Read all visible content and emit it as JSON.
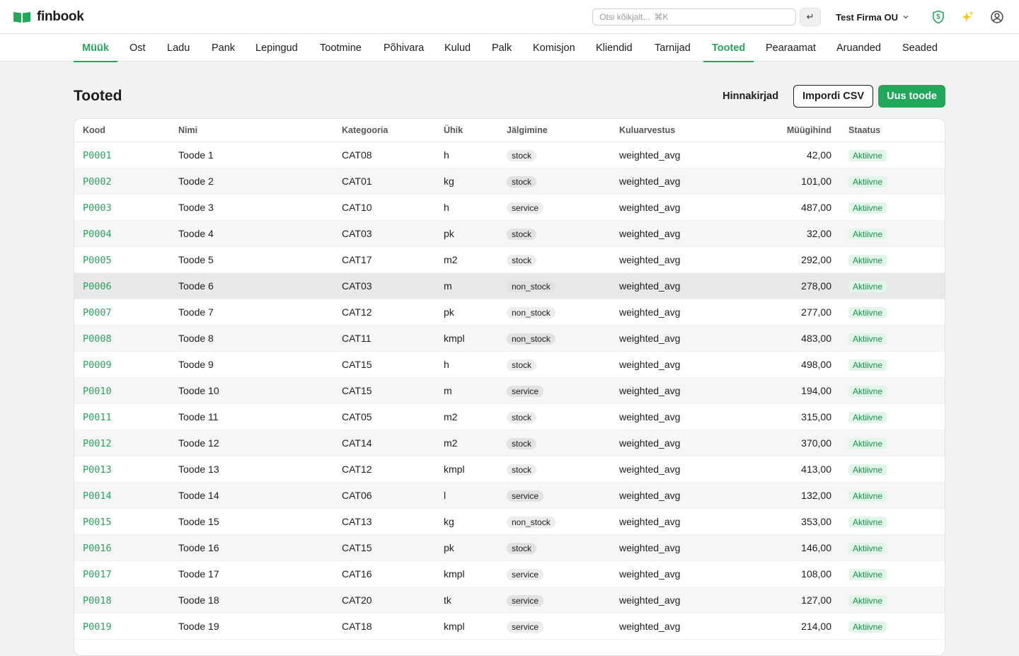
{
  "app": {
    "name": "finbook",
    "accent": "#22a85a"
  },
  "header": {
    "search_placeholder": "Otsi kõikjalt...",
    "search_shortcut": "⌘K",
    "enter_label": "↵",
    "company": "Test Firma OU",
    "icons": [
      "shield-icon",
      "sparkle-icon",
      "user-icon"
    ]
  },
  "nav": {
    "tabs": [
      {
        "label": "Müük",
        "active": true
      },
      {
        "label": "Ost",
        "active": false
      },
      {
        "label": "Ladu",
        "active": false
      },
      {
        "label": "Pank",
        "active": false
      },
      {
        "label": "Lepingud",
        "active": false
      },
      {
        "label": "Tootmine",
        "active": false
      },
      {
        "label": "Põhivara",
        "active": false
      },
      {
        "label": "Kulud",
        "active": false
      },
      {
        "label": "Palk",
        "active": false
      },
      {
        "label": "Komisjon",
        "active": false
      },
      {
        "label": "Kliendid",
        "active": false
      },
      {
        "label": "Tarnijad",
        "active": false
      },
      {
        "label": "Tooted",
        "active": true
      },
      {
        "label": "Pearaamat",
        "active": false
      },
      {
        "label": "Aruanded",
        "active": false
      },
      {
        "label": "Seaded",
        "active": false
      }
    ]
  },
  "page": {
    "title": "Tooted",
    "price_lists_label": "Hinnakirjad",
    "import_label": "Impordi CSV",
    "new_label": "Uus toode"
  },
  "table": {
    "columns": [
      "Kood",
      "Nimi",
      "Kategooria",
      "Ühik",
      "Jälgimine",
      "Kuluarvestus",
      "Müügihind",
      "Staatus"
    ],
    "rows": [
      {
        "code": "P0001",
        "name": "Toode 1",
        "category": "CAT08",
        "unit": "h",
        "tracking": "stock",
        "costing": "weighted_avg",
        "price": "42,00",
        "status": "Aktiivne"
      },
      {
        "code": "P0002",
        "name": "Toode 2",
        "category": "CAT01",
        "unit": "kg",
        "tracking": "stock",
        "costing": "weighted_avg",
        "price": "101,00",
        "status": "Aktiivne"
      },
      {
        "code": "P0003",
        "name": "Toode 3",
        "category": "CAT10",
        "unit": "h",
        "tracking": "service",
        "costing": "weighted_avg",
        "price": "487,00",
        "status": "Aktiivne"
      },
      {
        "code": "P0004",
        "name": "Toode 4",
        "category": "CAT03",
        "unit": "pk",
        "tracking": "stock",
        "costing": "weighted_avg",
        "price": "32,00",
        "status": "Aktiivne"
      },
      {
        "code": "P0005",
        "name": "Toode 5",
        "category": "CAT17",
        "unit": "m2",
        "tracking": "stock",
        "costing": "weighted_avg",
        "price": "292,00",
        "status": "Aktiivne"
      },
      {
        "code": "P0006",
        "name": "Toode 6",
        "category": "CAT03",
        "unit": "m",
        "tracking": "non_stock",
        "costing": "weighted_avg",
        "price": "278,00",
        "status": "Aktiivne"
      },
      {
        "code": "P0007",
        "name": "Toode 7",
        "category": "CAT12",
        "unit": "pk",
        "tracking": "non_stock",
        "costing": "weighted_avg",
        "price": "277,00",
        "status": "Aktiivne"
      },
      {
        "code": "P0008",
        "name": "Toode 8",
        "category": "CAT11",
        "unit": "kmpl",
        "tracking": "non_stock",
        "costing": "weighted_avg",
        "price": "483,00",
        "status": "Aktiivne"
      },
      {
        "code": "P0009",
        "name": "Toode 9",
        "category": "CAT15",
        "unit": "h",
        "tracking": "stock",
        "costing": "weighted_avg",
        "price": "498,00",
        "status": "Aktiivne"
      },
      {
        "code": "P0010",
        "name": "Toode 10",
        "category": "CAT15",
        "unit": "m",
        "tracking": "service",
        "costing": "weighted_avg",
        "price": "194,00",
        "status": "Aktiivne"
      },
      {
        "code": "P0011",
        "name": "Toode 11",
        "category": "CAT05",
        "unit": "m2",
        "tracking": "stock",
        "costing": "weighted_avg",
        "price": "315,00",
        "status": "Aktiivne"
      },
      {
        "code": "P0012",
        "name": "Toode 12",
        "category": "CAT14",
        "unit": "m2",
        "tracking": "stock",
        "costing": "weighted_avg",
        "price": "370,00",
        "status": "Aktiivne"
      },
      {
        "code": "P0013",
        "name": "Toode 13",
        "category": "CAT12",
        "unit": "kmpl",
        "tracking": "stock",
        "costing": "weighted_avg",
        "price": "413,00",
        "status": "Aktiivne"
      },
      {
        "code": "P0014",
        "name": "Toode 14",
        "category": "CAT06",
        "unit": "l",
        "tracking": "service",
        "costing": "weighted_avg",
        "price": "132,00",
        "status": "Aktiivne"
      },
      {
        "code": "P0015",
        "name": "Toode 15",
        "category": "CAT13",
        "unit": "kg",
        "tracking": "non_stock",
        "costing": "weighted_avg",
        "price": "353,00",
        "status": "Aktiivne"
      },
      {
        "code": "P0016",
        "name": "Toode 16",
        "category": "CAT15",
        "unit": "pk",
        "tracking": "stock",
        "costing": "weighted_avg",
        "price": "146,00",
        "status": "Aktiivne"
      },
      {
        "code": "P0017",
        "name": "Toode 17",
        "category": "CAT16",
        "unit": "kmpl",
        "tracking": "service",
        "costing": "weighted_avg",
        "price": "108,00",
        "status": "Aktiivne"
      },
      {
        "code": "P0018",
        "name": "Toode 18",
        "category": "CAT20",
        "unit": "tk",
        "tracking": "service",
        "costing": "weighted_avg",
        "price": "127,00",
        "status": "Aktiivne"
      },
      {
        "code": "P0019",
        "name": "Toode 19",
        "category": "CAT18",
        "unit": "kmpl",
        "tracking": "service",
        "costing": "weighted_avg",
        "price": "214,00",
        "status": "Aktiivne"
      }
    ]
  }
}
